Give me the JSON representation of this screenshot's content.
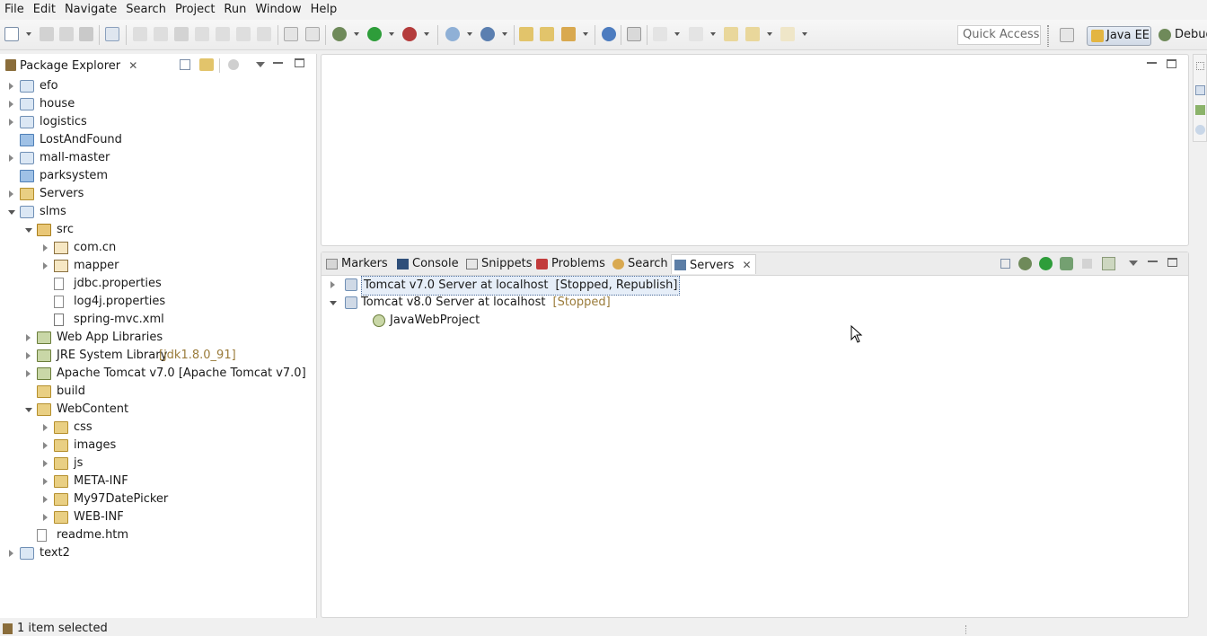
{
  "menu": [
    "File",
    "Edit",
    "Navigate",
    "Search",
    "Project",
    "Run",
    "Window",
    "Help"
  ],
  "toolbar": {
    "quick_access_placeholder": "Quick Access",
    "perspectives": [
      {
        "label": "Java EE",
        "active": true
      },
      {
        "label": "Debug",
        "active": false
      }
    ]
  },
  "package_explorer": {
    "title": "Package Explorer",
    "close": "✕",
    "tree": [
      {
        "label": "efo",
        "icon": "project-icon",
        "depth": 0,
        "state": "closed"
      },
      {
        "label": "house",
        "icon": "project-icon",
        "depth": 0,
        "state": "closed"
      },
      {
        "label": "logistics",
        "icon": "project-icon",
        "depth": 0,
        "state": "closed"
      },
      {
        "label": "LostAndFound",
        "icon": "folder-project-icon",
        "depth": 0,
        "state": "none"
      },
      {
        "label": "mall-master",
        "icon": "project-icon",
        "depth": 0,
        "state": "closed"
      },
      {
        "label": "parksystem",
        "icon": "folder-project-icon",
        "depth": 0,
        "state": "none"
      },
      {
        "label": "Servers",
        "icon": "folder-icon",
        "depth": 0,
        "state": "closed"
      },
      {
        "label": "slms",
        "icon": "project-icon",
        "depth": 0,
        "state": "open"
      },
      {
        "label": "src",
        "icon": "source-folder-icon",
        "depth": 1,
        "state": "open"
      },
      {
        "label": "com.cn",
        "icon": "package-icon",
        "depth": 2,
        "state": "closed"
      },
      {
        "label": "mapper",
        "icon": "package-icon",
        "depth": 2,
        "state": "closed"
      },
      {
        "label": "jdbc.properties",
        "icon": "file-icon",
        "depth": 2,
        "state": "none"
      },
      {
        "label": "log4j.properties",
        "icon": "file-icon",
        "depth": 2,
        "state": "none"
      },
      {
        "label": "spring-mvc.xml",
        "icon": "xml-file-icon",
        "depth": 2,
        "state": "none"
      },
      {
        "label": "Web App Libraries",
        "icon": "library-icon",
        "depth": 1,
        "state": "closed"
      },
      {
        "label": "JRE System Library",
        "decor": "[jdk1.8.0_91]",
        "icon": "library-icon",
        "depth": 1,
        "state": "closed"
      },
      {
        "label": "Apache Tomcat v7.0 [Apache Tomcat v7.0]",
        "icon": "library-icon",
        "depth": 1,
        "state": "closed"
      },
      {
        "label": "build",
        "icon": "folder-icon",
        "depth": 1,
        "state": "none"
      },
      {
        "label": "WebContent",
        "icon": "folder-icon",
        "depth": 1,
        "state": "open"
      },
      {
        "label": "css",
        "icon": "folder-icon",
        "depth": 2,
        "state": "closed"
      },
      {
        "label": "images",
        "icon": "folder-icon",
        "depth": 2,
        "state": "closed"
      },
      {
        "label": "js",
        "icon": "folder-icon",
        "depth": 2,
        "state": "closed"
      },
      {
        "label": "META-INF",
        "icon": "folder-icon",
        "depth": 2,
        "state": "closed"
      },
      {
        "label": "My97DatePicker",
        "icon": "folder-icon",
        "depth": 2,
        "state": "closed"
      },
      {
        "label": "WEB-INF",
        "icon": "folder-icon",
        "depth": 2,
        "state": "closed"
      },
      {
        "label": "readme.htm",
        "icon": "file-icon",
        "depth": 1,
        "state": "none"
      },
      {
        "label": "text2",
        "icon": "project-icon",
        "depth": 0,
        "state": "closed"
      }
    ]
  },
  "bottom_panel": {
    "tabs": [
      {
        "label": "Markers",
        "icon": "markers-icon",
        "active": false
      },
      {
        "label": "Console",
        "icon": "console-icon",
        "active": false
      },
      {
        "label": "Snippets",
        "icon": "snippets-icon",
        "active": false
      },
      {
        "label": "Problems",
        "icon": "problems-icon",
        "active": false
      },
      {
        "label": "Search",
        "icon": "search-icon",
        "active": false
      },
      {
        "label": "Servers",
        "icon": "servers-icon",
        "active": true
      }
    ],
    "close": "✕",
    "servers": [
      {
        "name": "Tomcat v7.0 Server at localhost",
        "status": "[Stopped, Republish]",
        "state": "closed",
        "selected": true,
        "depth": 0
      },
      {
        "name": "Tomcat v8.0 Server at localhost",
        "status": "[Stopped]",
        "state": "open",
        "selected": false,
        "depth": 0
      },
      {
        "name": "JavaWebProject",
        "status": "",
        "state": "none",
        "selected": false,
        "depth": 1
      }
    ]
  },
  "status_bar": {
    "text": "1 item selected"
  },
  "colors": {
    "selection_bg": "#e6eef8",
    "decoration": "#9a7b3a",
    "accent_blue": "#4d6d9a"
  }
}
